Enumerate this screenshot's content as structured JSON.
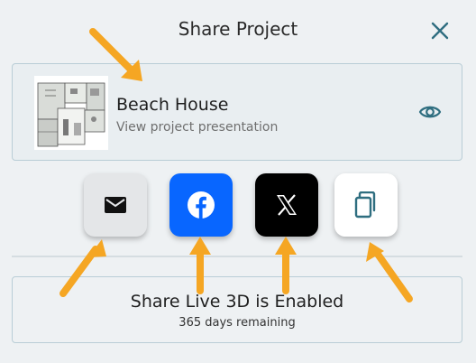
{
  "header": {
    "title": "Share Project",
    "close_icon": "close-icon"
  },
  "project": {
    "name": "Beach House",
    "subtitle": "View project presentation",
    "thumbnail_icon": "floor-plan-thumbnail",
    "view_icon": "eye-icon"
  },
  "share_buttons": [
    {
      "icon": "mail-icon",
      "color": "#e4e6e8"
    },
    {
      "icon": "facebook-icon",
      "color": "#0866ff"
    },
    {
      "icon": "x-icon",
      "color": "#000000"
    },
    {
      "icon": "copy-icon",
      "color": "#ffffff"
    }
  ],
  "live3d": {
    "title": "Share Live 3D is Enabled",
    "remaining": "365 days remaining"
  },
  "colors": {
    "accent": "#2f6e80",
    "annotation_arrow": "#f5a623"
  }
}
